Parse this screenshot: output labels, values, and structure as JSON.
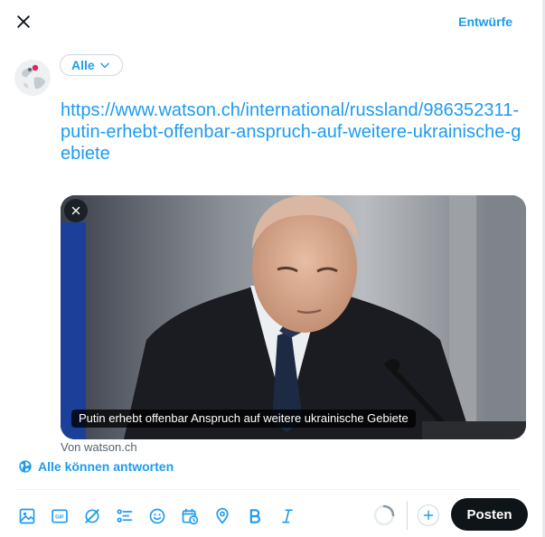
{
  "header": {
    "drafts_label": "Entwürfe"
  },
  "audience": {
    "label": "Alle"
  },
  "compose": {
    "text": "https://www.watson.ch/international/russland/986352311-putin-erhebt-offenbar-anspruch-auf-weitere-ukrainische-gebiete"
  },
  "link_card": {
    "caption": "Putin erhebt offenbar Anspruch auf weitere ukrainische Gebiete",
    "source": "Von watson.ch"
  },
  "reply_setting": {
    "label": "Alle können antworten"
  },
  "toolbar": {
    "icons": [
      "media-icon",
      "gif-icon",
      "grok-icon",
      "poll-icon",
      "emoji-icon",
      "schedule-icon",
      "location-icon",
      "bold-icon",
      "italic-icon"
    ]
  },
  "actions": {
    "post_label": "Posten"
  },
  "colors": {
    "accent": "#1d9bf0",
    "text": "#0f1419",
    "muted": "#536471",
    "border": "#cfd9de"
  }
}
